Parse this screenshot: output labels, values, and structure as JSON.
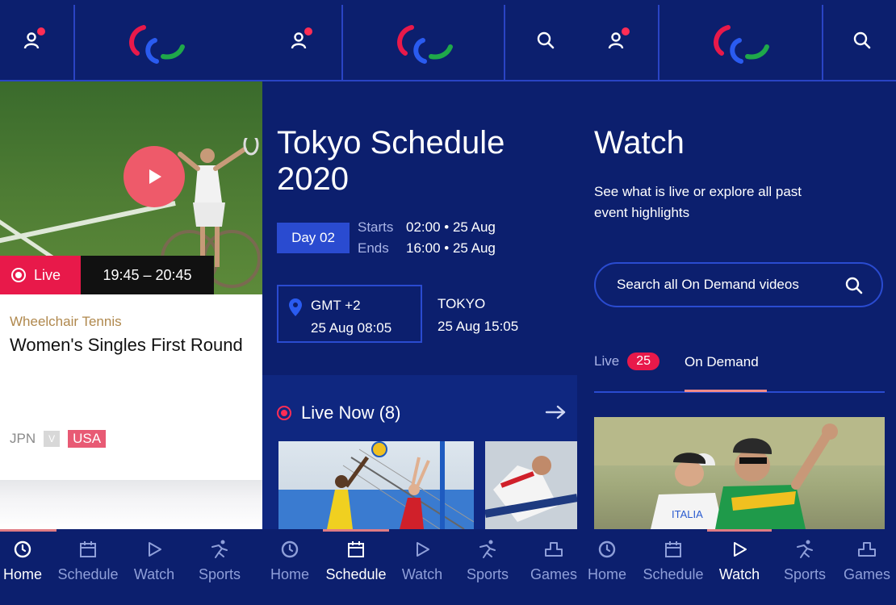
{
  "home": {
    "live_label": "Live",
    "time_range": "19:45 – 20:45",
    "sport": "Wheelchair Tennis",
    "event_title": "Women's Singles First Round",
    "team_home": "JPN",
    "vs": "V",
    "team_away": "USA"
  },
  "schedule": {
    "title": "Tokyo Schedule 2020",
    "day": "Day 02",
    "starts_label": "Starts",
    "starts_value": "02:00 • 25 Aug",
    "ends_label": "Ends",
    "ends_value": "16:00 • 25 Aug",
    "tz_label": "GMT +2",
    "tz_time": "25 Aug 08:05",
    "tokyo_label": "TOKYO",
    "tokyo_time": "25 Aug 15:05",
    "live_now": "Live Now (8)"
  },
  "watch": {
    "title": "Watch",
    "description": "See what is live or explore all past event highlights",
    "search_placeholder": "Search all On Demand videos",
    "tab_live": "Live",
    "live_count": "25",
    "tab_on_demand": "On Demand",
    "italia_text": "ITALIA"
  },
  "nav": {
    "home": "Home",
    "schedule": "Schedule",
    "watch": "Watch",
    "sports": "Sports",
    "games": "Games"
  },
  "colors": {
    "background": "#0c1f6e",
    "accent_blue": "#2a4bd0",
    "live_red": "#e8194a",
    "play_pink": "#ee5a6a",
    "gold": "#b0884d"
  },
  "icons": [
    "profile-icon",
    "paralympic-logo",
    "search-icon",
    "play-icon",
    "location-pin-icon",
    "arrow-right-icon",
    "clock-icon",
    "calendar-icon",
    "sports-icon",
    "podium-icon"
  ]
}
